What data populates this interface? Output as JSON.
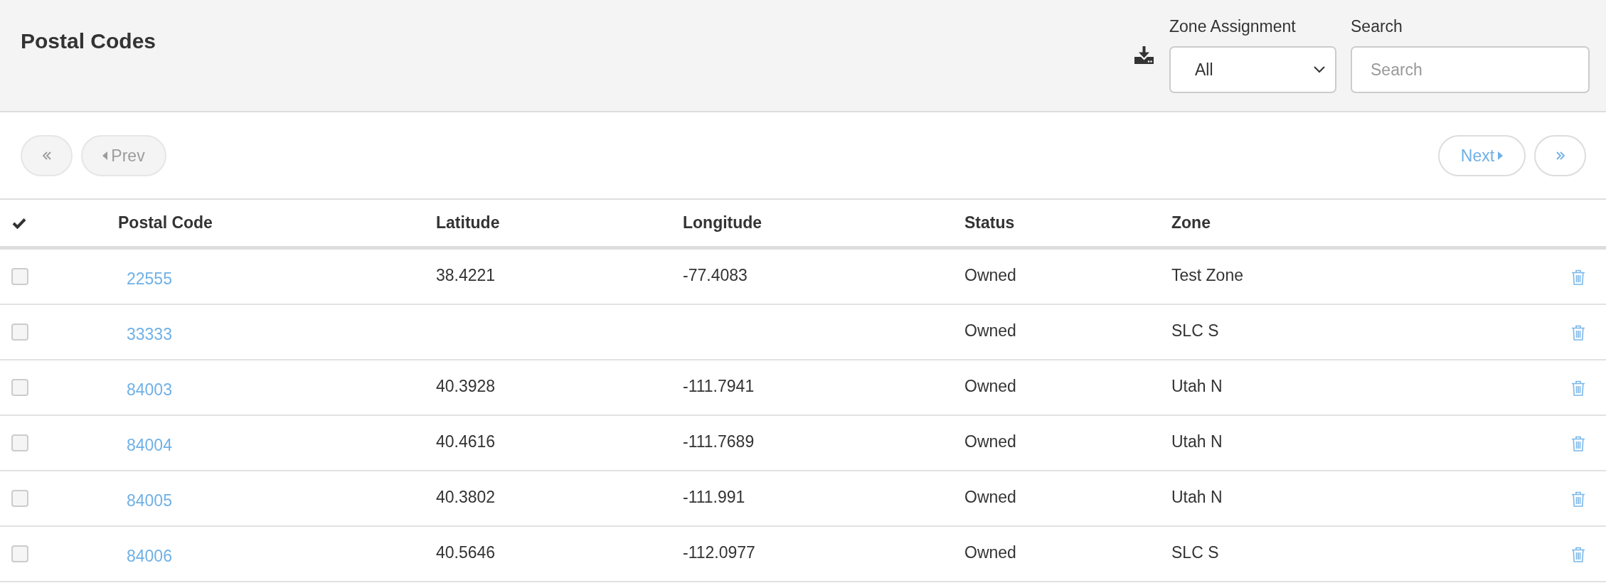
{
  "header": {
    "title": "Postal Codes",
    "zone_filter": {
      "label": "Zone Assignment",
      "value": "All"
    },
    "search": {
      "label": "Search",
      "placeholder": "Search"
    }
  },
  "pagination": [
    {
      "kind": "first",
      "disabled": true
    },
    {
      "kind": "prev",
      "label": "Prev",
      "disabled": true
    },
    {
      "kind": "next",
      "label": "Next",
      "disabled": false
    },
    {
      "kind": "last",
      "disabled": false
    }
  ],
  "table": {
    "columns": [
      "Postal Code",
      "Latitude",
      "Longitude",
      "Status",
      "Zone"
    ],
    "rows": [
      {
        "checked": false,
        "postal_code": "22555",
        "latitude": "38.4221",
        "longitude": "-77.4083",
        "status": "Owned",
        "zone": "Test Zone"
      },
      {
        "checked": false,
        "postal_code": "33333",
        "status": "Owned",
        "zone": "SLC S"
      },
      {
        "checked": false,
        "postal_code": "84003",
        "latitude": "40.3928",
        "longitude": "-111.7941",
        "status": "Owned",
        "zone": "Utah N"
      },
      {
        "checked": false,
        "postal_code": "84004",
        "latitude": "40.4616",
        "longitude": "-111.7689",
        "status": "Owned",
        "zone": "Utah N"
      },
      {
        "checked": false,
        "postal_code": "84005",
        "latitude": "40.3802",
        "longitude": "-111.991",
        "status": "Owned",
        "zone": "Utah N"
      },
      {
        "checked": false,
        "postal_code": "84006",
        "latitude": "40.5646",
        "longitude": "-112.0977",
        "status": "Owned",
        "zone": "SLC S"
      }
    ]
  }
}
